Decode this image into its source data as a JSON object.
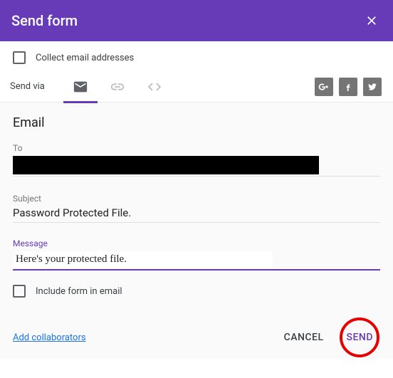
{
  "header": {
    "title": "Send form"
  },
  "collect_label": "Collect email addresses",
  "send_via_label": "Send via",
  "email": {
    "heading": "Email",
    "to_label": "To",
    "subject_label": "Subject",
    "subject_value": "Password Protected File.",
    "message_label": "Message",
    "message_value": "Here's your protected file.",
    "include_label": "Include form in email"
  },
  "footer": {
    "add_collaborators": "Add collaborators",
    "cancel": "CANCEL",
    "send": "SEND"
  }
}
